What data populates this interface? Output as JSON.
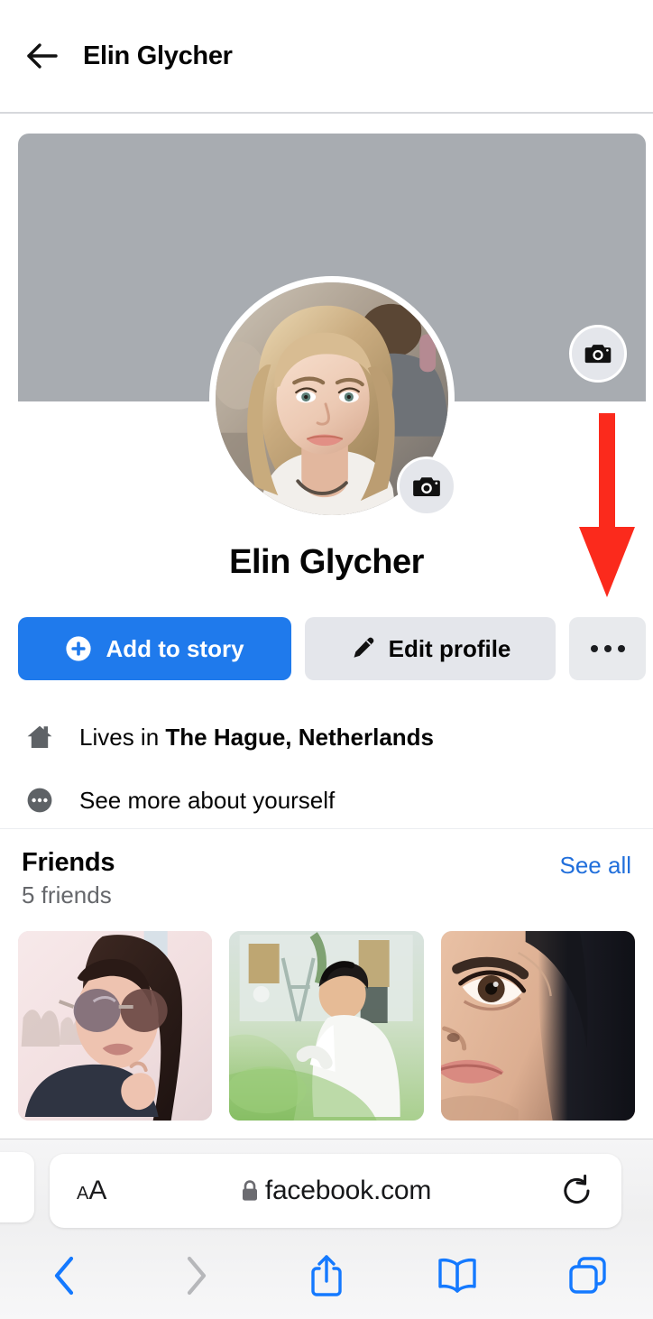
{
  "header": {
    "back_icon": "back-arrow-icon",
    "title": "Elin Glycher"
  },
  "cover": {
    "color": "#a8acb1",
    "camera_icon": "camera-icon"
  },
  "profile": {
    "photo_alt": "profile-photo",
    "camera_icon": "camera-icon",
    "name": "Elin Glycher"
  },
  "annotation": {
    "type": "down-arrow",
    "color": "#fb2a1c",
    "points_to": "more-options-button"
  },
  "actions": {
    "add_story_label": "Add to story",
    "add_story_icon": "plus-circle-icon",
    "add_story_color": "#1f7aec",
    "edit_profile_label": "Edit profile",
    "edit_profile_icon": "pencil-icon",
    "edit_profile_color": "#e4e6eb",
    "more_label": "",
    "more_icon": "ellipsis-icon"
  },
  "info": {
    "rows": [
      {
        "icon": "home-icon",
        "prefix": "Lives in ",
        "bold": "The Hague, Netherlands"
      },
      {
        "icon": "ellipsis-circle-icon",
        "prefix": "See more about yourself",
        "bold": ""
      }
    ]
  },
  "friends": {
    "title": "Friends",
    "count_label": "5 friends",
    "see_all_label": "See all",
    "see_all_color": "#216fdb",
    "tiles": [
      {
        "alt": "friend-photo-sunglasses-woman"
      },
      {
        "alt": "friend-photo-man-white-shirt"
      },
      {
        "alt": "friend-photo-closeup-woman"
      }
    ]
  },
  "safari": {
    "text_size_small": "A",
    "text_size_large": "A",
    "lock_icon": "lock-icon",
    "url": "facebook.com",
    "reload_icon": "reload-icon",
    "toolbar": [
      {
        "name": "back-button",
        "icon": "chevron-left-icon",
        "enabled": true
      },
      {
        "name": "forward-button",
        "icon": "chevron-right-icon",
        "enabled": false
      },
      {
        "name": "share-button",
        "icon": "share-icon",
        "enabled": true
      },
      {
        "name": "bookmarks-button",
        "icon": "book-icon",
        "enabled": true
      },
      {
        "name": "tabs-button",
        "icon": "tabs-icon",
        "enabled": true
      }
    ],
    "accent_color": "#1479ff"
  }
}
